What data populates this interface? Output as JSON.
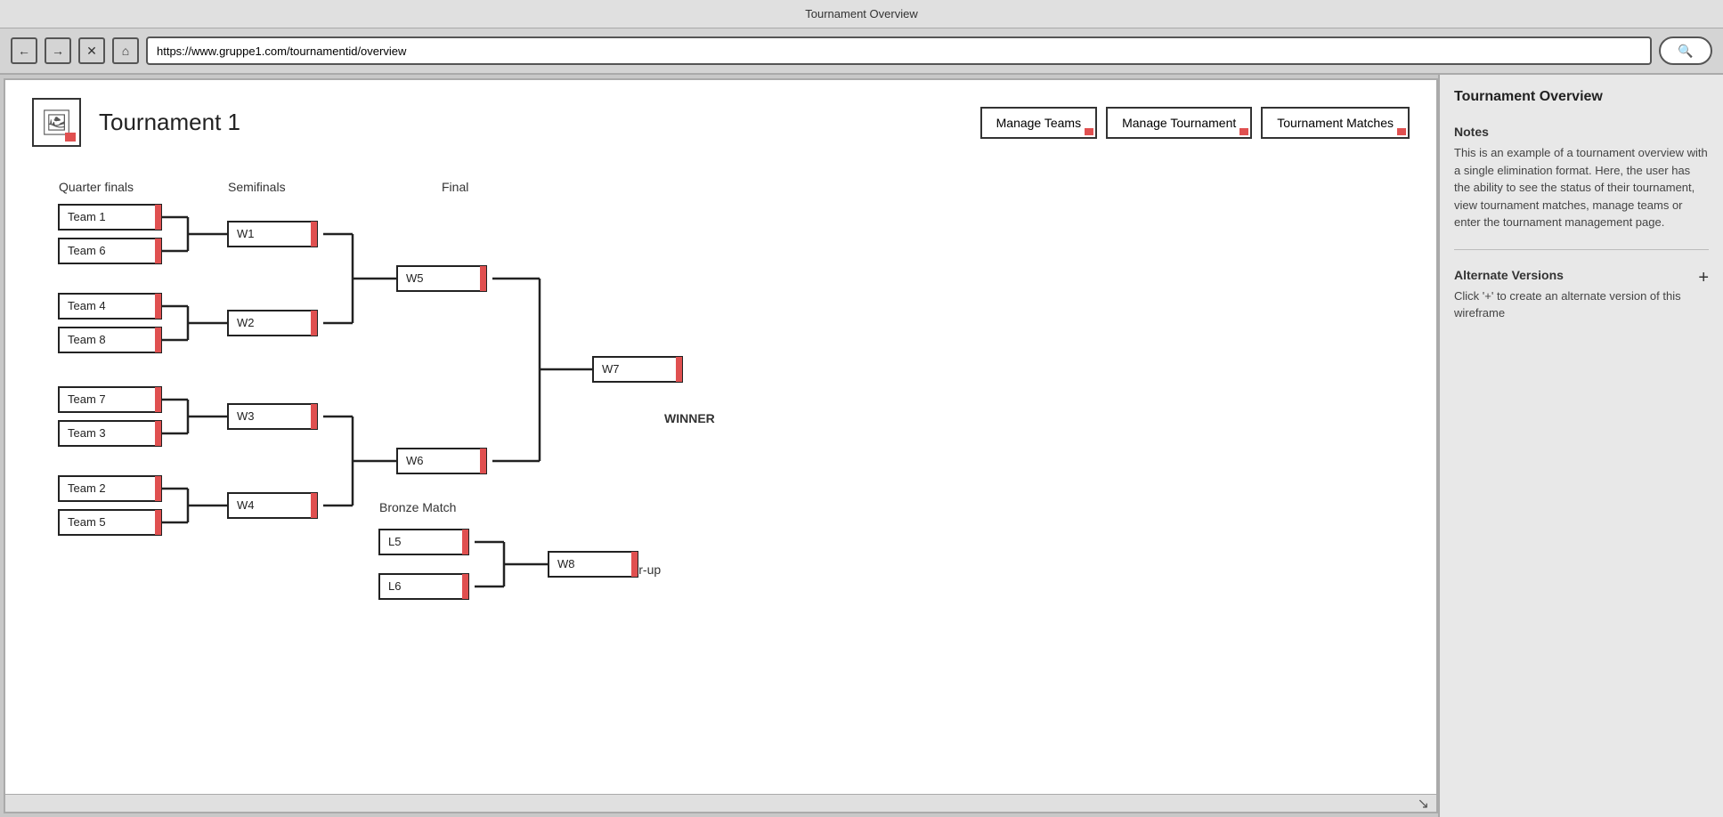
{
  "titleBar": {
    "title": "Tournament Overview"
  },
  "browserBar": {
    "url": "https://www.gruppe1.com/tournamentid/overview",
    "searchPlaceholder": "🔍"
  },
  "page": {
    "tournamentName": "Tournament 1",
    "buttons": {
      "manageTeams": "Manage Teams",
      "manageTournament": "Manage Tournament",
      "tournamentMatches": "Tournament Matches"
    },
    "labels": {
      "quarterFinals": "Quarter finals",
      "semifinals": "Semifinals",
      "final": "Final",
      "winner": "WINNER",
      "bronzeMatch": "Bronze Match",
      "runnerUp": "Runner-up"
    },
    "teams": [
      "Team 1",
      "Team 6",
      "Team 4",
      "Team 8",
      "Team 7",
      "Team 3",
      "Team 2",
      "Team 5"
    ],
    "matches": [
      "W1",
      "W2",
      "W3",
      "W4",
      "W5",
      "W6",
      "W7",
      "W8",
      "L5",
      "L6"
    ]
  },
  "rightPanel": {
    "title": "Tournament Overview",
    "notesTitle": "Notes",
    "notesText": "This is an example of a tournament overview with a single elimination format. Here, the user has the ability to see the status of their tournament, view tournament matches, manage teams or enter the tournament management page.",
    "altVersionsTitle": "Alternate Versions",
    "altVersionsText": "Click '+' to create an alternate version of this wireframe",
    "plusBtn": "+"
  }
}
